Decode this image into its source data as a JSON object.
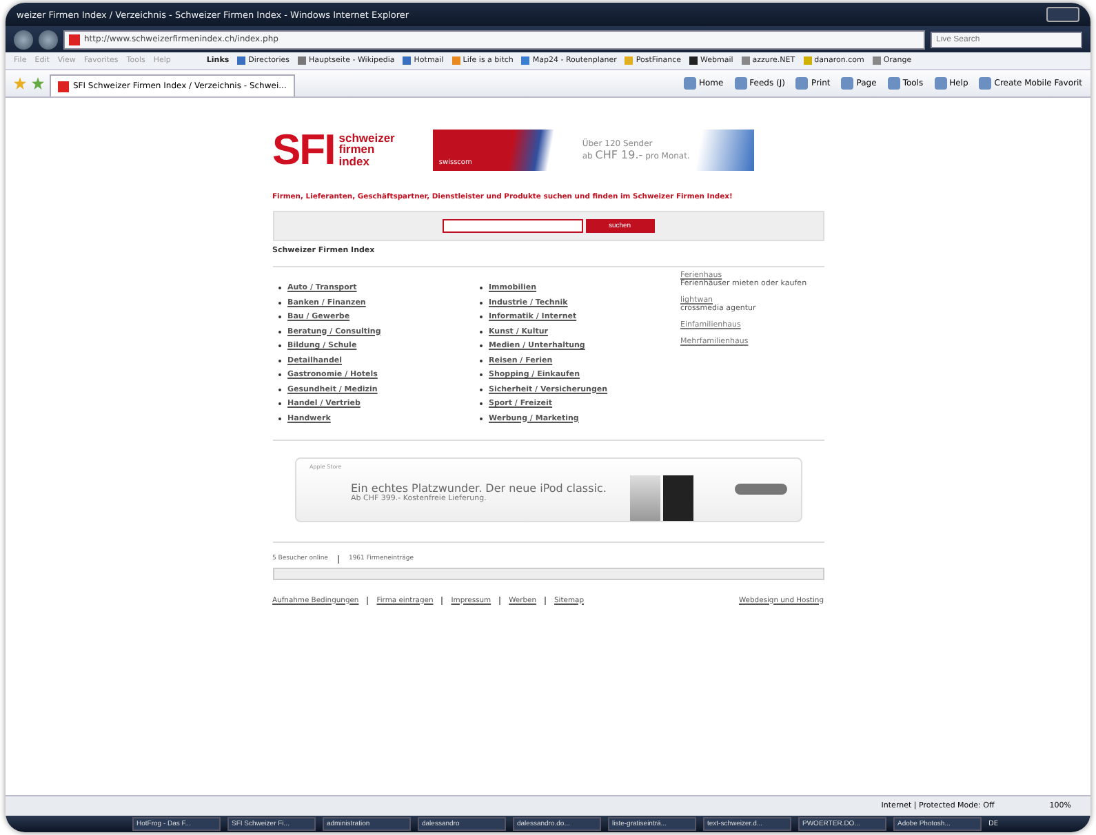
{
  "window": {
    "title": "weizer Firmen Index / Verzeichnis - Schweizer Firmen Index - Windows Internet Explorer"
  },
  "address_bar": {
    "url": "http://www.schweizerfirmenindex.ch/index.php",
    "search_placeholder": "Live Search"
  },
  "menu": [
    "File",
    "Edit",
    "View",
    "Favorites",
    "Tools",
    "Help"
  ],
  "links_bar": {
    "label": "Links",
    "items": [
      "Directories",
      "Hauptseite - Wikipedia",
      "Hotmail",
      "Life is a bitch",
      "Map24 - Routenplaner",
      "PostFinance",
      "Webmail",
      "azzure.NET",
      "danaron.com",
      "Orange"
    ]
  },
  "tab": {
    "title": "SFI Schweizer Firmen Index / Verzeichnis - Schwei...",
    "selected": true
  },
  "command_bar": [
    "Home",
    "Feeds (J)",
    "Print",
    "Page",
    "Tools",
    "Help",
    "Create Mobile Favorit"
  ],
  "page": {
    "logo": {
      "mark": "SFI",
      "words": [
        "schweizer",
        "firmen",
        "index"
      ]
    },
    "banner": {
      "brand": "swisscom",
      "line1": "Über 120 Sender",
      "prefix": "ab",
      "price": "CHF 19.-",
      "suffix": "pro Monat."
    },
    "tagline": "Firmen, Lieferanten, Geschäftspartner, Dienstleister und Produkte suchen und finden im Schweizer Firmen Index!",
    "search_button": "suchen",
    "section_title": "Schweizer Firmen Index",
    "category_columns": [
      [
        "Auto / Transport",
        "Banken / Finanzen",
        "Bau / Gewerbe",
        "Beratung / Consulting",
        "Bildung / Schule",
        "Detailhandel",
        "Gastronomie / Hotels",
        "Gesundheit / Medizin",
        "Handel / Vertrieb",
        "Handwerk"
      ],
      [
        "Immobilien",
        "Industrie / Technik",
        "Informatik / Internet",
        "Kunst / Kultur",
        "Medien / Unterhaltung",
        "Reisen / Ferien",
        "Shopping / Einkaufen",
        "Sicherheit / Versicherungen",
        "Sport / Freizeit",
        "Werbung / Marketing"
      ]
    ],
    "side_links": [
      {
        "title": "Ferienhaus",
        "subtitle": "Ferienhäuser mieten oder kaufen"
      },
      {
        "title": "lightwan",
        "subtitle": "crossmedia agentur"
      },
      {
        "title": "Einfamilienhaus"
      },
      {
        "title": "Mehrfamilienhaus"
      }
    ],
    "ad": {
      "store": "Apple Store",
      "headline": "Ein echtes Platzwunder. Der neue iPod classic.",
      "subline": "Ab CHF 399.- Kostenfreie Lieferung."
    },
    "stats": [
      "5 Besucher online",
      "1961 Firmeneinträge"
    ],
    "footer_links": [
      "Aufnahme Bedingungen",
      "Firma eintragen",
      "Impressum",
      "Werben",
      "Sitemap"
    ],
    "credit_link": "Webdesign und Hosting"
  },
  "status_bar": {
    "zone": "Internet | Protected Mode: Off",
    "zoom": "100%"
  },
  "taskbar": {
    "items": [
      "HotFrog - Das F...",
      "SFI Schweizer Fi...",
      "administration",
      "dalessandro",
      "dalessandro.do...",
      "liste-gratiseinträ...",
      "text-schweizer.d...",
      "PWOERTER.DO...",
      "Adobe Photosh..."
    ],
    "language": "DE"
  }
}
